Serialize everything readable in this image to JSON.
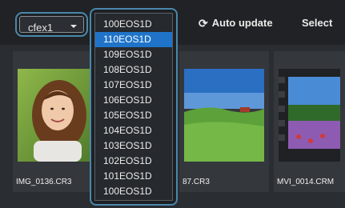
{
  "toolbar": {
    "card_value": "cfex1",
    "auto_update_label": "Auto update",
    "select_label": "Select"
  },
  "dropdown": {
    "items": [
      "100EOS1D",
      "110EOS1D",
      "109EOS1D",
      "108EOS1D",
      "107EOS1D",
      "106EOS1D",
      "105EOS1D",
      "104EOS1D",
      "103EOS1D",
      "102EOS1D",
      "101EOS1D",
      "100EOS1D"
    ],
    "selected_index": 1
  },
  "thumbnails": [
    {
      "name": "IMG_0136.CR3"
    },
    {
      "name": "87.CR3"
    },
    {
      "name": "MVI_0014.CRM"
    }
  ],
  "colors": {
    "highlight": "#1f74c9",
    "outline": "#4a88ad"
  }
}
